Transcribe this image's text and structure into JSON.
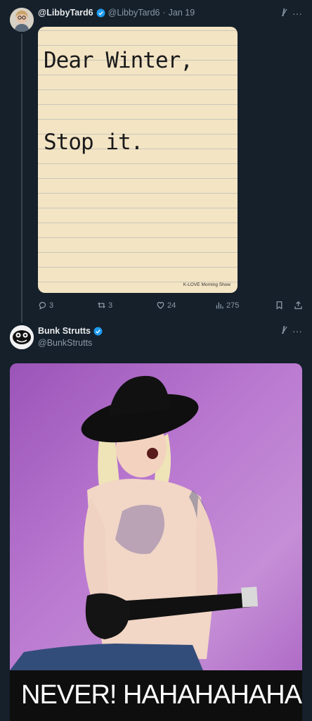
{
  "tweet1": {
    "display_name": "@LibbyTard6",
    "handle": "@LibbyTard6",
    "separator": "·",
    "date": "Jan 19",
    "image_text": {
      "line1": "Dear Winter,",
      "line2": "Stop it.",
      "credit": "K-LOVE Morning Show"
    },
    "actions": {
      "replies": "3",
      "reposts": "3",
      "likes": "24",
      "views": "275"
    }
  },
  "tweet2": {
    "display_name": "Bunk Strutts",
    "handle": "@BunkStrutts",
    "image_caption": "NEVER! HAHAHAHAHA"
  },
  "icons": {
    "verified": "verified-badge-icon",
    "grok": "grok-icon",
    "more": "more-icon",
    "reply": "reply-icon",
    "repost": "repost-icon",
    "like": "like-icon",
    "views": "views-icon",
    "bookmark": "bookmark-icon",
    "share": "share-icon"
  },
  "colors": {
    "background": "#15202b",
    "text_primary": "#e7e9ea",
    "text_secondary": "#8b98a5",
    "verified": "#1d9bf0"
  }
}
